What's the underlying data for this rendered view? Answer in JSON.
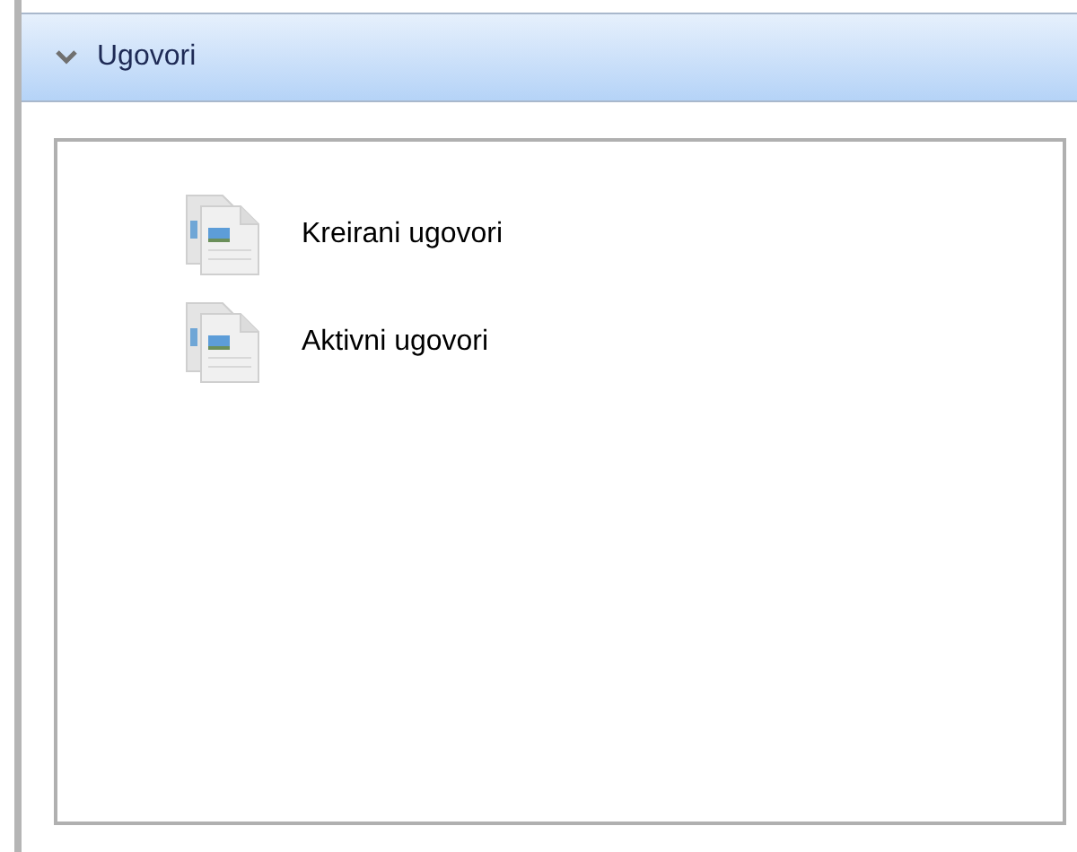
{
  "panel": {
    "title": "Ugovori",
    "expanded": true
  },
  "items": [
    {
      "label": "Kreirani ugovori"
    },
    {
      "label": "Aktivni ugovori"
    }
  ]
}
